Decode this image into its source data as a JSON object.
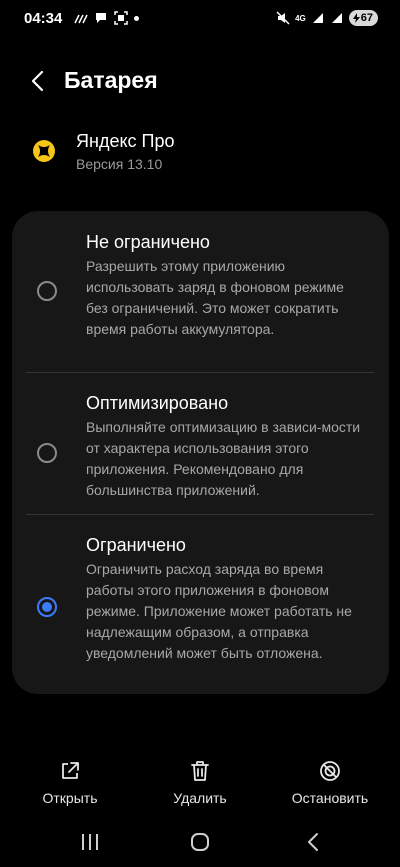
{
  "status_bar": {
    "time": "04:34",
    "network": "4G",
    "battery_level": "67"
  },
  "header": {
    "title": "Батарея"
  },
  "app": {
    "name": "Яндекс Про",
    "version": "Версия 13.10"
  },
  "options": [
    {
      "title": "Не ограничено",
      "description": "Разрешить этому приложению использовать заряд в фоновом режиме без ограничений. Это может сократить время работы аккумулятора.",
      "selected": false
    },
    {
      "title": "Оптимизировано",
      "description": "Выполняйте оптимизацию в зависи-мости от характера использования этого приложения. Рекомендовано для большинства приложений.",
      "selected": false
    },
    {
      "title": "Ограничено",
      "description": "Ограничить расход заряда во время работы этого приложения в фоновом режиме. Приложение может работать не надлежащим образом, а отправка уведомлений может быть отложена.",
      "selected": true
    }
  ],
  "actions": {
    "open_label": "Открыть",
    "delete_label": "Удалить",
    "stop_label": "Остановить"
  },
  "colors": {
    "accent": "#3e7bfa",
    "card_bg": "#171717",
    "app_icon": "#f5c518"
  }
}
